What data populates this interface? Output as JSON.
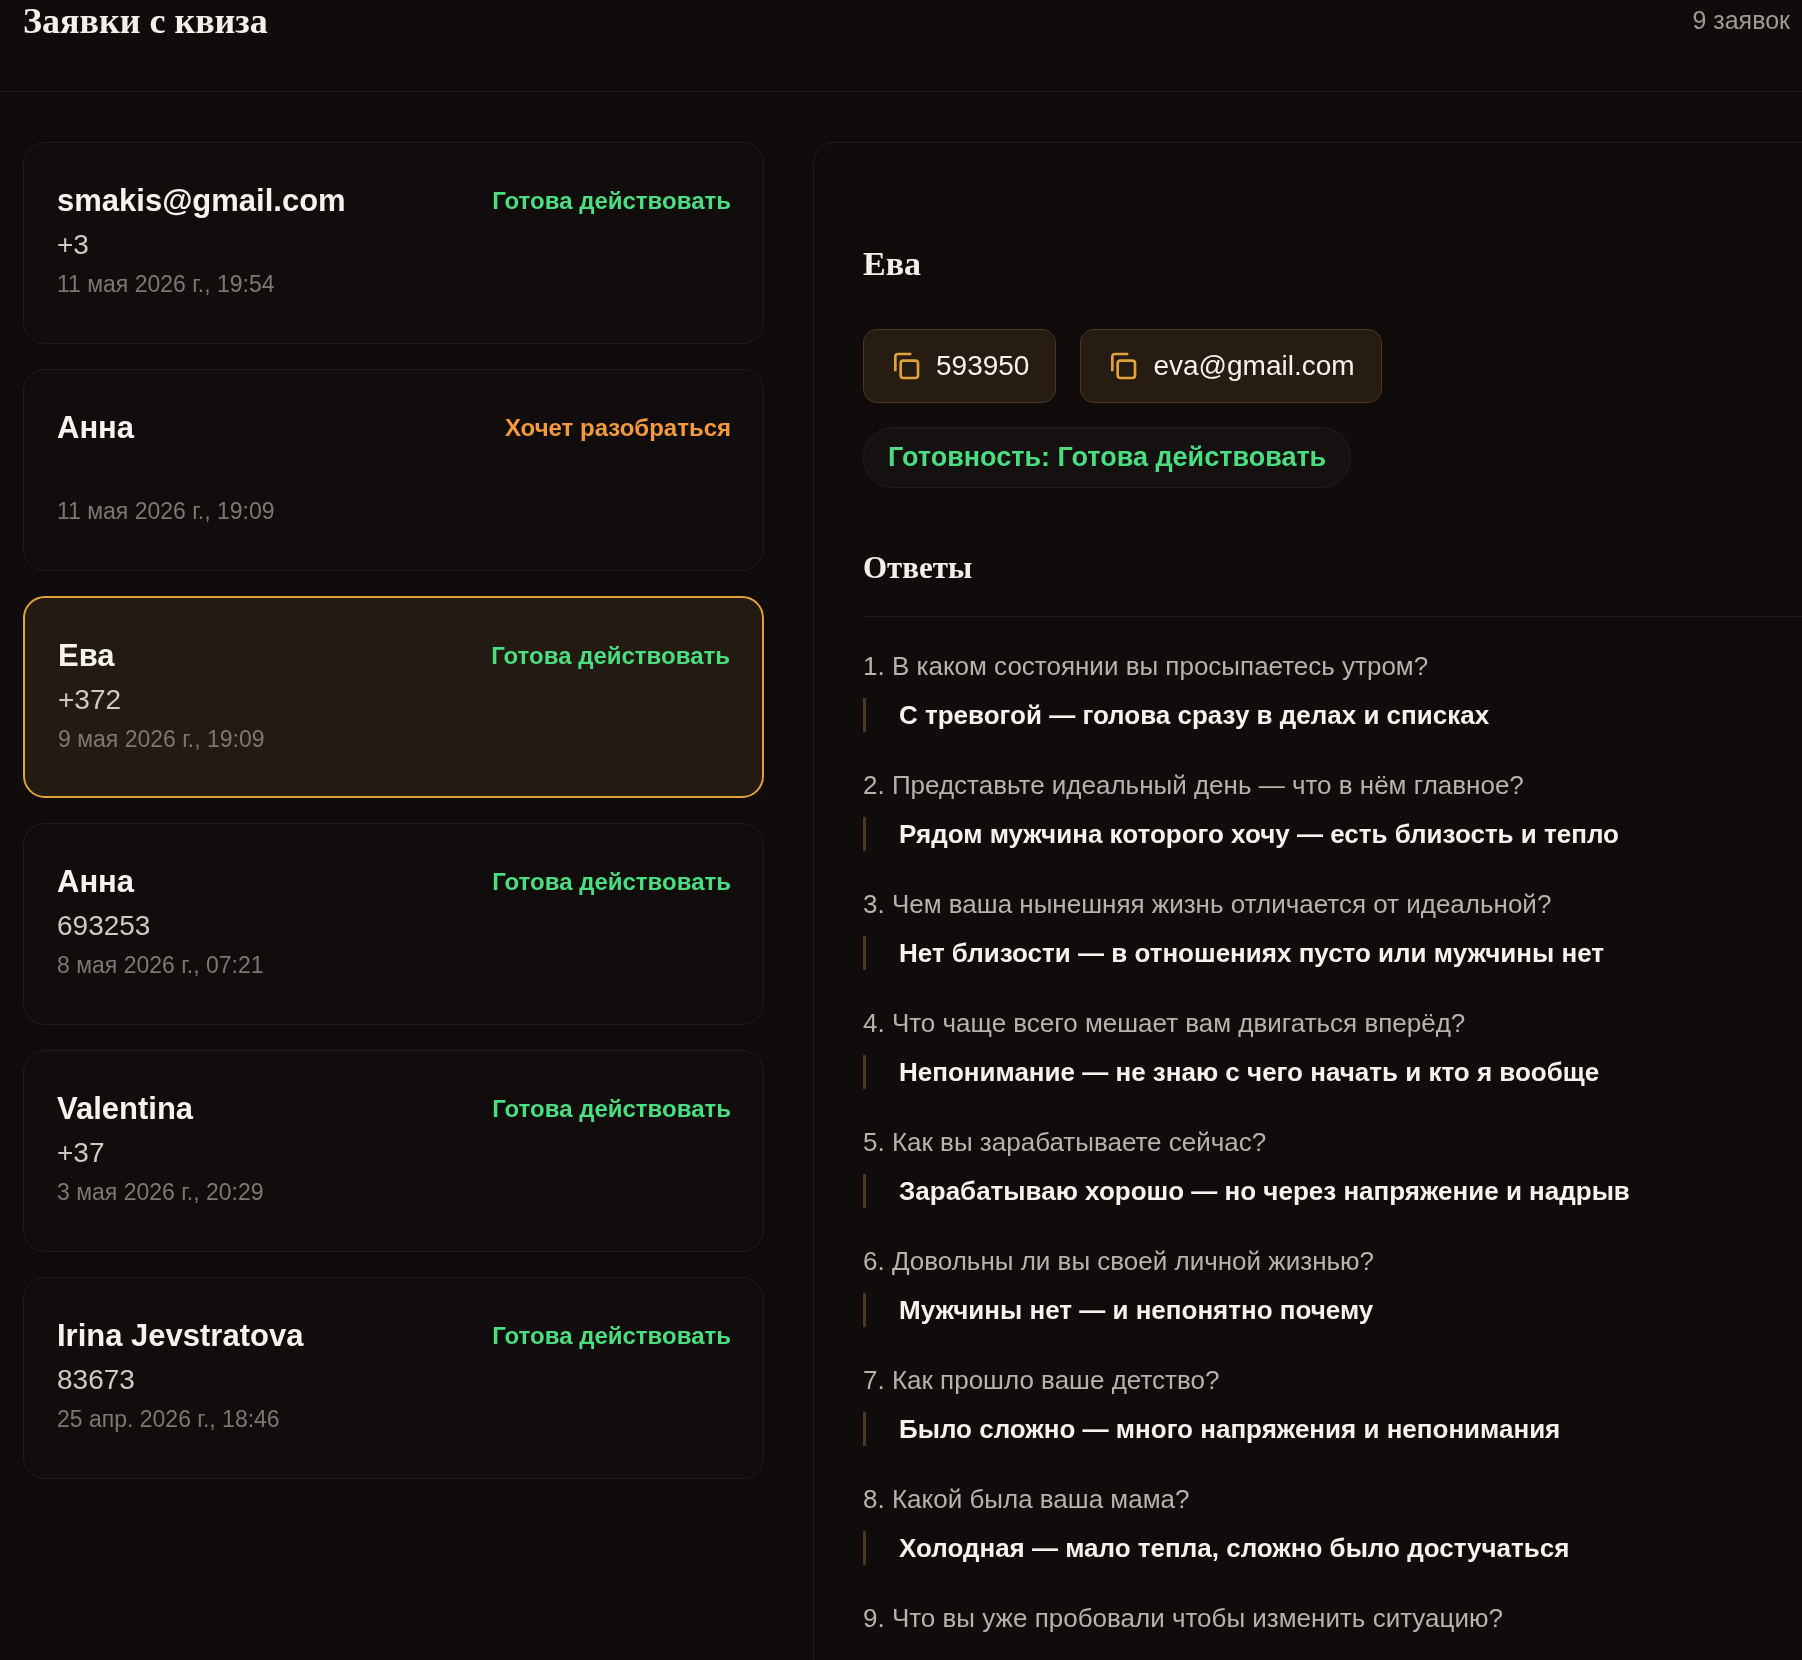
{
  "header": {
    "title": "Заявки с квиза",
    "count": "9 заявок"
  },
  "leads": [
    {
      "name": "smakis@gmail.com",
      "phone": "+3",
      "status": "Готова действовать",
      "color": "#4ade80",
      "date": "11 мая 2026 г., 19:54",
      "selected": false
    },
    {
      "name": "Анна",
      "status": "Хочет разобраться",
      "color": "#f59a3c",
      "date": "11 мая 2026 г., 19:09",
      "selected": false
    },
    {
      "name": "Ева",
      "phone": "+372",
      "status": "Готова действовать",
      "color": "#4ade80",
      "date": "9 мая 2026 г., 19:09",
      "selected": true
    },
    {
      "name": "Анна",
      "phone": "693253",
      "status": "Готова действовать",
      "color": "#4ade80",
      "date": "8 мая 2026 г., 07:21",
      "selected": false
    },
    {
      "name": "Valentina",
      "phone": "+37",
      "status": "Готова действовать",
      "color": "#4ade80",
      "date": "3 мая 2026 г., 20:29",
      "selected": false
    },
    {
      "name": "Irina Jevstratova",
      "phone": "83673",
      "status": "Готова действовать",
      "color": "#4ade80",
      "date": "25 апр. 2026 г., 18:46",
      "selected": false
    }
  ],
  "detail": {
    "name": "Ева",
    "contacts": [
      "593950",
      "eva@gmail.com"
    ],
    "readiness": "Готовность: Готова действовать",
    "answers_title": "Ответы",
    "answers": [
      {
        "question": "1. В каком состоянии вы просыпаетесь утром?",
        "answer": "С тревогой — голова сразу в делах и списках"
      },
      {
        "question": "2. Представьте идеальный день — что в нём главное?",
        "answer": "Рядом мужчина которого хочу — есть близость и тепло"
      },
      {
        "question": "3. Чем ваша нынешняя жизнь отличается от идеальной?",
        "answer": "Нет близости — в отношениях пусто или мужчины нет"
      },
      {
        "question": "4. Что чаще всего мешает вам двигаться вперёд?",
        "answer": "Непонимание — не знаю с чего начать и кто я вообще"
      },
      {
        "question": "5. Как вы зарабатываете сейчас?",
        "answer": "Зарабатываю хорошо — но через напряжение и надрыв"
      },
      {
        "question": "6. Довольны ли вы своей личной жизнью?",
        "answer": "Мужчины нет — и непонятно почему"
      },
      {
        "question": "7. Как прошло ваше детство?",
        "answer": "Было сложно — много напряжения и непонимания"
      },
      {
        "question": "8. Какой была ваша мама?",
        "answer": "Холодная — мало тепла, сложно было достучаться"
      },
      {
        "question": "9. Что вы уже пробовали чтобы изменить ситуацию?"
      }
    ]
  }
}
